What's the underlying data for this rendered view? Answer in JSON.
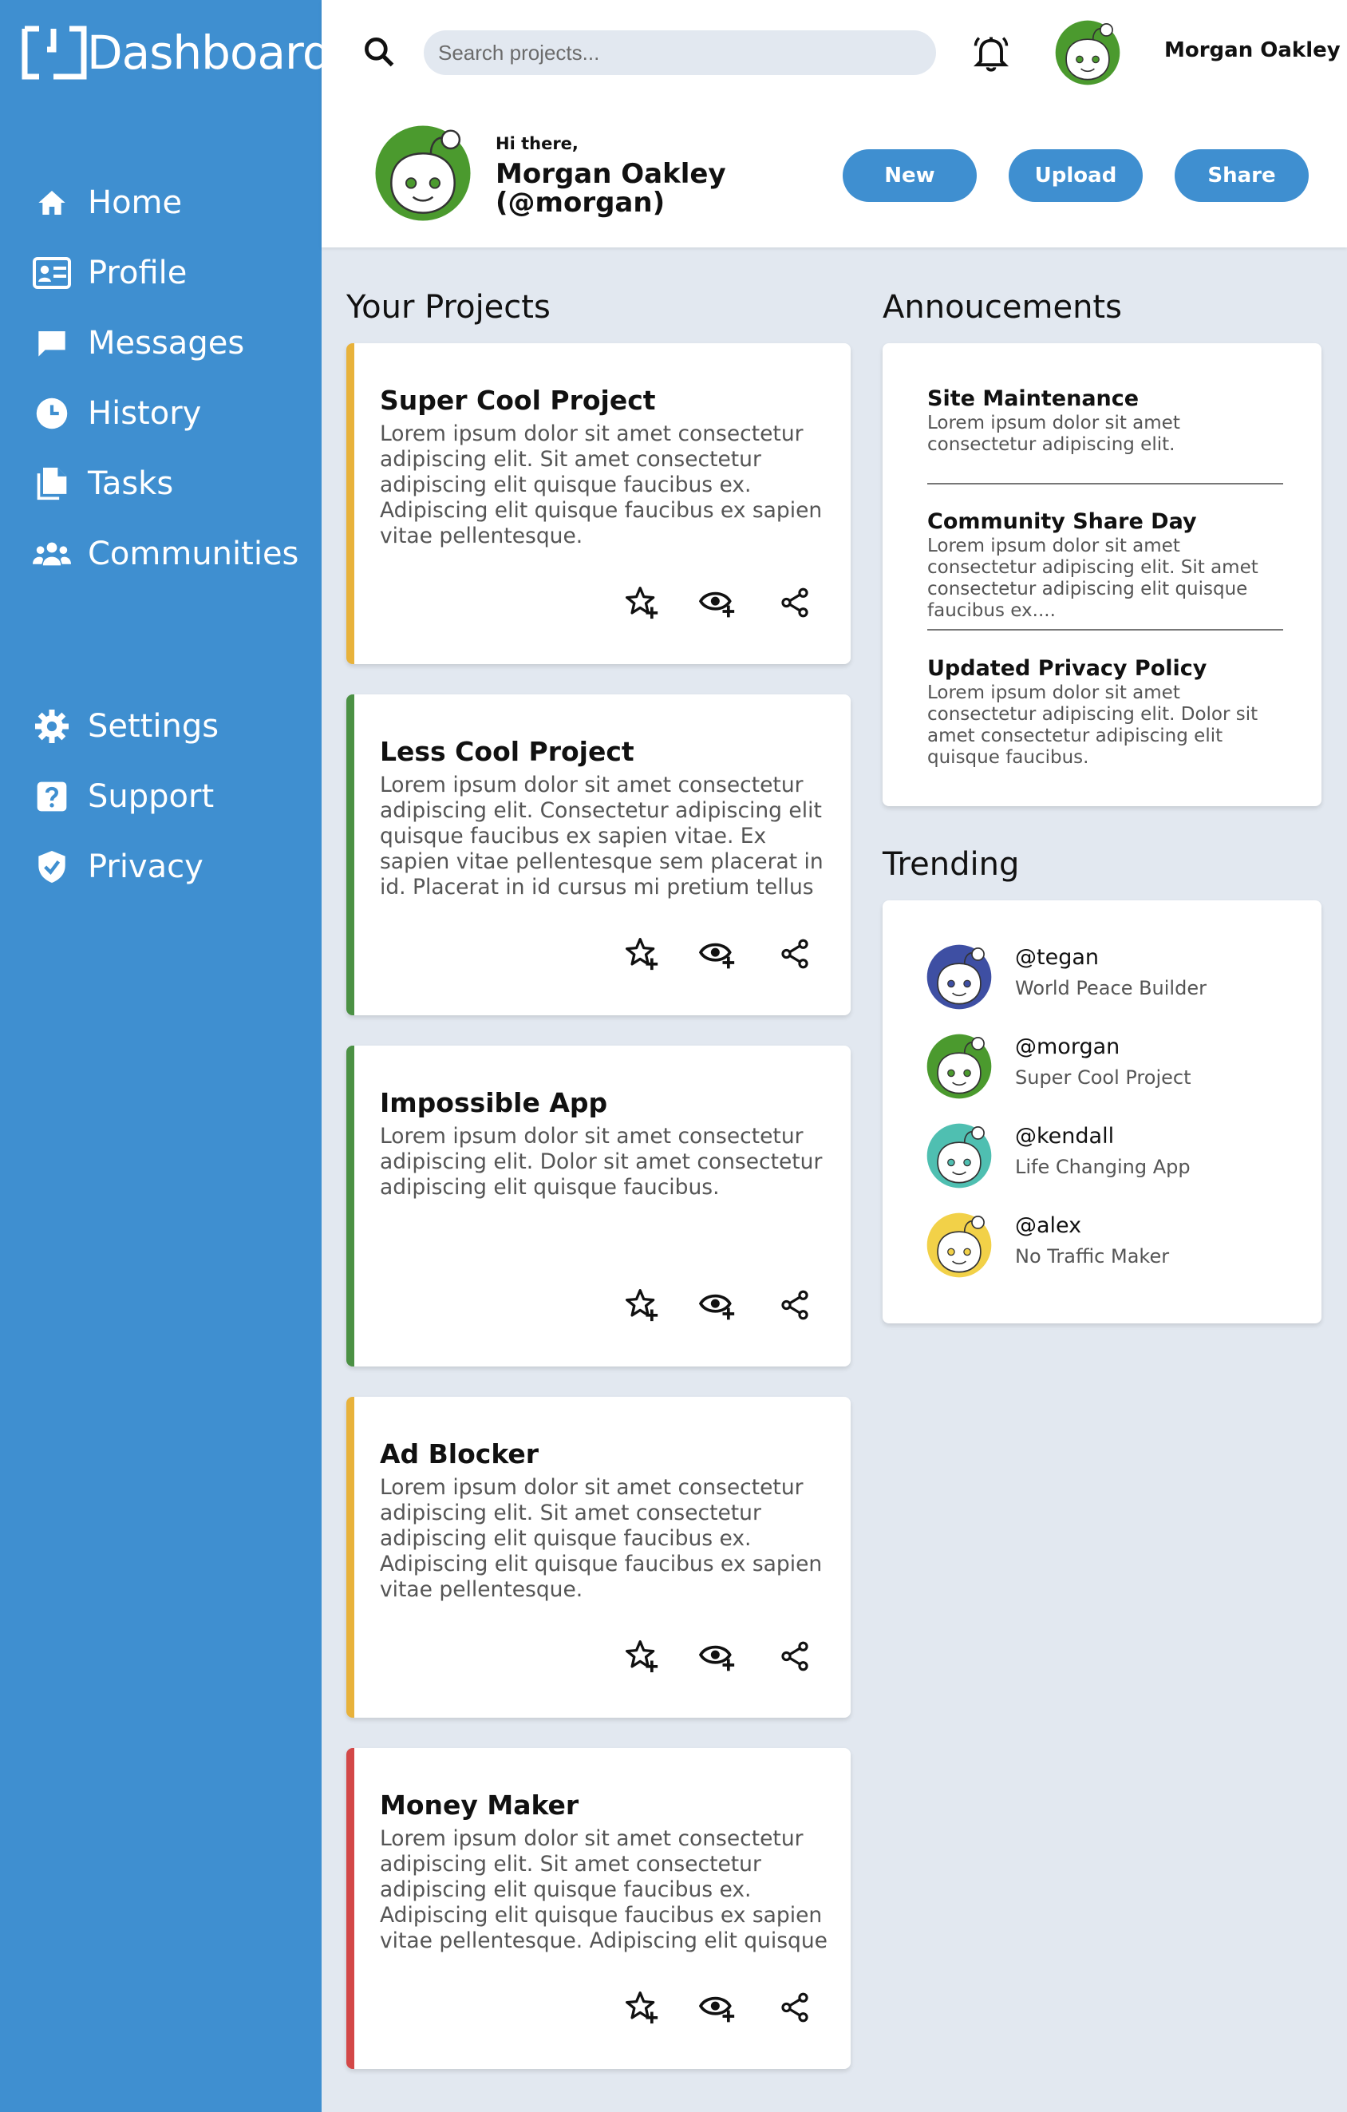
{
  "brand": {
    "name": "Dashboard"
  },
  "sidebar": {
    "items": [
      {
        "label": "Home",
        "icon": "home-icon"
      },
      {
        "label": "Profile",
        "icon": "id-card-icon"
      },
      {
        "label": "Messages",
        "icon": "message-icon"
      },
      {
        "label": "History",
        "icon": "clock-icon"
      },
      {
        "label": "Tasks",
        "icon": "documents-icon"
      },
      {
        "label": "Communities",
        "icon": "users-icon"
      },
      {
        "label": "Settings",
        "icon": "gear-icon"
      },
      {
        "label": "Support",
        "icon": "question-icon"
      },
      {
        "label": "Privacy",
        "icon": "shield-icon"
      }
    ]
  },
  "topbar": {
    "search_placeholder": "Search projects...",
    "username": "Morgan Oakley"
  },
  "profile": {
    "greeting": "Hi there,",
    "name": "Morgan Oakley",
    "handle": "(@morgan)"
  },
  "actions": {
    "new": "New",
    "upload": "Upload",
    "share": "Share"
  },
  "projects": {
    "heading": "Your Projects",
    "items": [
      {
        "title": "Super Cool Project",
        "desc": "Lorem ipsum dolor sit amet consectetur adipiscing elit. Sit amet consectetur adipiscing elit quisque faucibus ex. Adipiscing elit quisque faucibus ex sapien vitae pellentesque.",
        "accent": "#e8b23b"
      },
      {
        "title": "Less Cool Project",
        "desc": "Lorem ipsum dolor sit amet consectetur adipiscing elit. Consectetur adipiscing elit quisque faucibus ex sapien vitae. Ex sapien vitae pellentesque sem placerat in id. Placerat in id cursus mi pretium tellus duis. Pretium…",
        "accent": "#4b9144"
      },
      {
        "title": "Impossible App",
        "desc": "Lorem ipsum dolor sit amet consectetur adipiscing elit. Dolor sit amet consectetur adipiscing elit quisque faucibus.",
        "accent": "#4b9144"
      },
      {
        "title": "Ad Blocker",
        "desc": "Lorem ipsum dolor sit amet consectetur adipiscing elit. Sit amet consectetur adipiscing elit quisque faucibus ex. Adipiscing elit quisque faucibus ex sapien vitae pellentesque.",
        "accent": "#e8b23b"
      },
      {
        "title": "Money Maker",
        "desc": "Lorem ipsum dolor sit amet consectetur adipiscing elit. Sit amet consectetur adipiscing elit quisque faucibus ex. Adipiscing elit quisque faucibus ex sapien vitae pellentesque. Adipiscing elit quisque faucibus ex sapien…",
        "accent": "#d34848"
      }
    ]
  },
  "announcements": {
    "heading": "Annoucements",
    "items": [
      {
        "title": "Site Maintenance",
        "text": "Lorem ipsum dolor sit amet consectetur adipiscing elit."
      },
      {
        "title": "Community Share Day",
        "text": "Lorem ipsum dolor sit amet consectetur adipiscing elit. Sit amet consectetur adipiscing elit quisque faucibus ex...."
      },
      {
        "title": "Updated Privacy Policy",
        "text": "Lorem ipsum dolor sit amet consectetur adipiscing elit. Dolor sit amet consectetur adipiscing elit quisque faucibus."
      }
    ]
  },
  "trending": {
    "heading": "Trending",
    "items": [
      {
        "handle": "@tegan",
        "project": "World Peace Builder",
        "color": "#3e4fa3"
      },
      {
        "handle": "@morgan",
        "project": "Super Cool Project",
        "color": "#4b9a2e"
      },
      {
        "handle": "@kendall",
        "project": "Life Changing App",
        "color": "#4fbfb1"
      },
      {
        "handle": "@alex",
        "project": "No Traffic Maker",
        "color": "#f2d148"
      }
    ]
  }
}
